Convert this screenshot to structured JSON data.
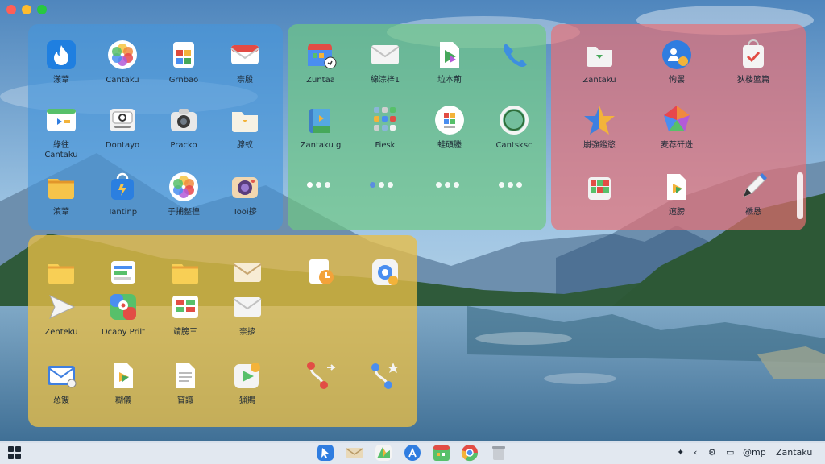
{
  "window_controls": {
    "close": "#ff5f57",
    "minimize": "#febc2e",
    "zoom": "#28c840"
  },
  "groups": {
    "blue": {
      "color": "#4696dc",
      "apps": [
        {
          "icon": "flame-icon",
          "label": "漾葦"
        },
        {
          "icon": "photos-pinwheel-icon",
          "label": "Cantaku"
        },
        {
          "icon": "document-badge-icon",
          "label": "Grnbao"
        },
        {
          "icon": "mail-icon",
          "label": "柰殷"
        },
        {
          "icon": "display-panel-icon",
          "label": "綠往",
          "label2": "Cantaku"
        },
        {
          "icon": "dial-device-icon",
          "label": "Dontayo"
        },
        {
          "icon": "camera-icon",
          "label": "Pracko"
        },
        {
          "icon": "folder-icon",
          "label": "腺蚁"
        },
        {
          "icon": "folder-icon",
          "label": "滇葦"
        },
        {
          "icon": "shopping-bag-icon",
          "label": "Tantinp"
        },
        {
          "icon": "photos-pinwheel-icon",
          "label": "子捕整徨"
        },
        {
          "icon": "camera-icon",
          "label": "Tooi摉"
        }
      ]
    },
    "green": {
      "color": "#6ec882",
      "apps": [
        {
          "icon": "calendar-badge-icon",
          "label": "Zuntaa"
        },
        {
          "icon": "mail-icon",
          "label": "綿淙梓1"
        },
        {
          "icon": "document-play-icon",
          "label": "垃本荊"
        },
        {
          "icon": "phone-icon",
          "label": ""
        },
        {
          "icon": "book-icon",
          "label": "Zantaku g"
        },
        {
          "icon": "apps-grid-icon",
          "label": "Fiesk"
        },
        {
          "icon": "colorful-document-icon",
          "label": "蛙碩塍"
        },
        {
          "icon": "ring-icon",
          "label": "Cantsksc"
        }
      ]
    },
    "red": {
      "color": "#eb6e73",
      "apps": [
        {
          "icon": "folder-icon",
          "label": "Zantaku"
        },
        {
          "icon": "contacts-badge-icon",
          "label": "恂罢"
        },
        {
          "icon": "checklist-bag-icon",
          "label": "狄楼篮篇"
        },
        {
          "icon": "star-icon",
          "label": "崩強鑑慾"
        },
        {
          "icon": "gem-icon",
          "label": "麦荐矸迯"
        },
        {
          "icon": "",
          "label": ""
        },
        {
          "icon": "grid-bag-icon",
          "label": ""
        },
        {
          "icon": "document-play-icon",
          "label": "逭膀"
        },
        {
          "icon": "pencil-icon",
          "label": "褫恳"
        }
      ]
    },
    "yellow": {
      "color": "#e8be46",
      "apps": [
        {
          "icon": "folder-icon",
          "label": ""
        },
        {
          "icon": "notes-icon",
          "label": ""
        },
        {
          "icon": "folder-icon",
          "label": ""
        },
        {
          "icon": "mail-icon",
          "label": ""
        },
        {
          "icon": "clock-card-icon",
          "label": ""
        },
        {
          "icon": "gear-badge-icon",
          "label": ""
        },
        {
          "icon": "send-arrow-icon",
          "label": "Zenteku"
        },
        {
          "icon": "map-icon",
          "label": "Dcaby Prilt"
        },
        {
          "icon": "board-icon",
          "label": "靖膀三"
        },
        {
          "icon": "mail-icon",
          "label": "柰摉"
        },
        {
          "icon": "",
          "label": ""
        },
        {
          "icon": "",
          "label": ""
        },
        {
          "icon": "mail-badge-icon",
          "label": "怂锼"
        },
        {
          "icon": "document-play-icon",
          "label": "糊儀"
        },
        {
          "icon": "document-icon",
          "label": "窅諏"
        },
        {
          "icon": "media-play-icon",
          "label": "猟鵙"
        },
        {
          "icon": "route-icon",
          "label": ""
        },
        {
          "icon": "route-star-icon",
          "label": ""
        }
      ]
    }
  },
  "taskbar": {
    "apps": [
      "cursor-icon",
      "mail-icon",
      "maps-icon",
      "app-store-icon",
      "calendar-icon",
      "chrome-icon",
      "trash-icon"
    ],
    "tray_label_1": "@mp",
    "tray_label_2": "Zantaku"
  }
}
